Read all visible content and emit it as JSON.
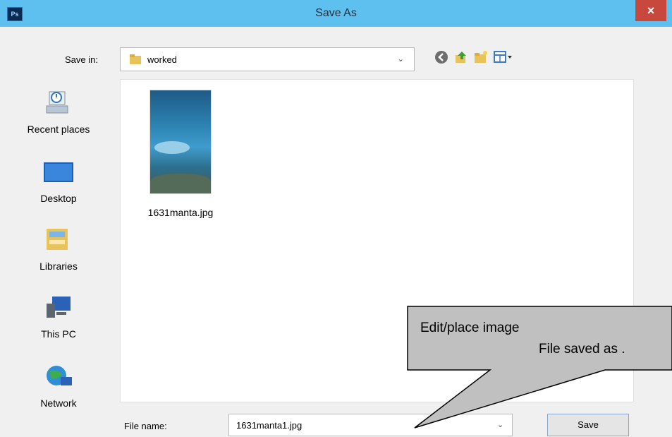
{
  "window": {
    "title": "Save As",
    "app_icon_text": "Ps",
    "close_glyph": "×"
  },
  "save_in": {
    "label": "Save in:",
    "folder": "worked"
  },
  "toolbar": {
    "icons": [
      "back-icon",
      "up-folder-icon",
      "new-folder-icon",
      "view-menu-icon"
    ]
  },
  "places": [
    {
      "label": "Recent places",
      "icon": "recent-places-icon"
    },
    {
      "label": "Desktop",
      "icon": "desktop-icon"
    },
    {
      "label": "Libraries",
      "icon": "libraries-icon"
    },
    {
      "label": "This PC",
      "icon": "this-pc-icon"
    },
    {
      "label": "Network",
      "icon": "network-icon"
    }
  ],
  "files": [
    {
      "name": "1631manta.jpg"
    }
  ],
  "filename": {
    "label": "File name:",
    "value": "1631manta1.jpg"
  },
  "buttons": {
    "save": "Save"
  },
  "callout": {
    "line1": "Edit/place image",
    "line2": "File saved as ."
  },
  "colors": {
    "titlebar": "#5ec0ee",
    "close": "#c9483d",
    "dialog_bg": "#f0f0f0",
    "callout_fill": "#c0c0c0"
  }
}
